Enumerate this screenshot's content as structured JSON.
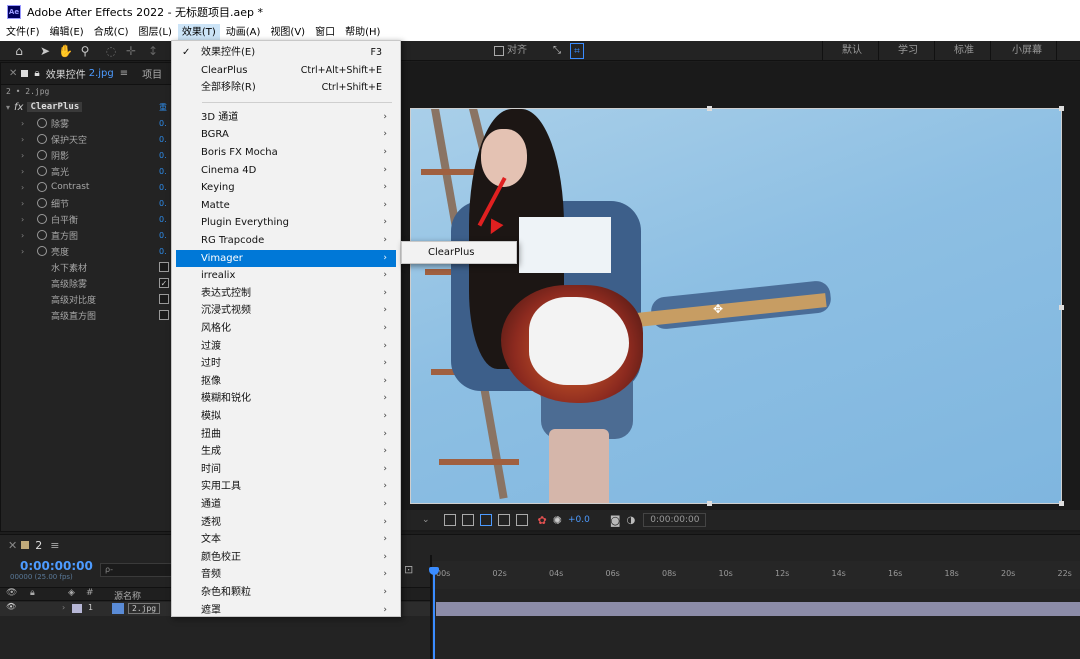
{
  "window": {
    "logo": "Ae",
    "title": "Adobe After Effects 2022 - 无标题项目.aep *"
  },
  "menubar": [
    "文件(F)",
    "编辑(E)",
    "合成(C)",
    "图层(L)",
    "效果(T)",
    "动画(A)",
    "视图(V)",
    "窗口",
    "帮助(H)"
  ],
  "toolbar": {
    "snap_label": "对齐",
    "workspaces": [
      "默认",
      "学习",
      "标准",
      "小屏幕"
    ]
  },
  "effects_panel": {
    "tab_title": "效果控件",
    "tab_file": "2.jpg",
    "tab_project": "项目",
    "layer_path": "2 • 2.jpg",
    "fx_badge": "fx",
    "effect_name": "ClearPlus",
    "effect_value": "重",
    "properties": [
      {
        "label": "除雾",
        "value": "0.",
        "type": "value"
      },
      {
        "label": "保护天空",
        "value": "0.",
        "type": "value"
      },
      {
        "label": "阴影",
        "value": "0.",
        "type": "value"
      },
      {
        "label": "高光",
        "value": "0.",
        "type": "value"
      },
      {
        "label": "Contrast",
        "value": "0.",
        "type": "value"
      },
      {
        "label": "细节",
        "value": "0.",
        "type": "value"
      },
      {
        "label": "白平衡",
        "value": "0.",
        "type": "value"
      },
      {
        "label": "直方图",
        "value": "0.",
        "type": "value"
      },
      {
        "label": "亮度",
        "value": "0.",
        "type": "value"
      },
      {
        "label": "水下素材",
        "checked": false,
        "type": "checkbox"
      },
      {
        "label": "高级除雾",
        "checked": true,
        "type": "checkbox"
      },
      {
        "label": "高级对比度",
        "checked": false,
        "type": "checkbox"
      },
      {
        "label": "高级直方图",
        "checked": false,
        "type": "checkbox"
      }
    ]
  },
  "viewer": {
    "timecode": "0:00:00:00",
    "exposure": "+0.0"
  },
  "timeline": {
    "tab_label": "2",
    "current_time": "0:00:00:00",
    "frames": "00000 (25.00 fps)",
    "search_placeholder": "ρ-",
    "col_source_name": "源名称",
    "layer_number": "1",
    "layer_name": "2.jpg",
    "ruler_ticks": [
      "00s",
      "02s",
      "04s",
      "06s",
      "08s",
      "10s",
      "12s",
      "14s",
      "16s",
      "18s",
      "20s",
      "22s"
    ]
  },
  "effect_menu": {
    "items": [
      {
        "label": "效果控件(E)",
        "shortcut": "F3",
        "checked": true
      },
      {
        "label": "ClearPlus",
        "shortcut": "Ctrl+Alt+Shift+E"
      },
      {
        "label": "全部移除(R)",
        "shortcut": "Ctrl+Shift+E"
      },
      {
        "label": "3D 通道",
        "submenu": true
      },
      {
        "label": "BGRA",
        "submenu": true
      },
      {
        "label": "Boris FX Mocha",
        "submenu": true
      },
      {
        "label": "Cinema 4D",
        "submenu": true
      },
      {
        "label": "Keying",
        "submenu": true
      },
      {
        "label": "Matte",
        "submenu": true
      },
      {
        "label": "Plugin Everything",
        "submenu": true
      },
      {
        "label": "RG Trapcode",
        "submenu": true
      },
      {
        "label": "Vimager",
        "submenu": true,
        "highlighted": true
      },
      {
        "label": "irrealix",
        "submenu": true
      },
      {
        "label": "表达式控制",
        "submenu": true
      },
      {
        "label": "沉浸式视频",
        "submenu": true
      },
      {
        "label": "风格化",
        "submenu": true
      },
      {
        "label": "过渡",
        "submenu": true
      },
      {
        "label": "过时",
        "submenu": true
      },
      {
        "label": "抠像",
        "submenu": true
      },
      {
        "label": "模糊和锐化",
        "submenu": true
      },
      {
        "label": "模拟",
        "submenu": true
      },
      {
        "label": "扭曲",
        "submenu": true
      },
      {
        "label": "生成",
        "submenu": true
      },
      {
        "label": "时间",
        "submenu": true
      },
      {
        "label": "实用工具",
        "submenu": true
      },
      {
        "label": "通道",
        "submenu": true
      },
      {
        "label": "透视",
        "submenu": true
      },
      {
        "label": "文本",
        "submenu": true
      },
      {
        "label": "颜色校正",
        "submenu": true
      },
      {
        "label": "音频",
        "submenu": true
      },
      {
        "label": "杂色和颗粒",
        "submenu": true
      },
      {
        "label": "遮罩",
        "submenu": true
      }
    ],
    "submenu_item": "ClearPlus"
  },
  "colors": {
    "accent_blue": "#0078d7",
    "timecode_blue": "#4d9bff",
    "panel_bg": "#232323"
  }
}
